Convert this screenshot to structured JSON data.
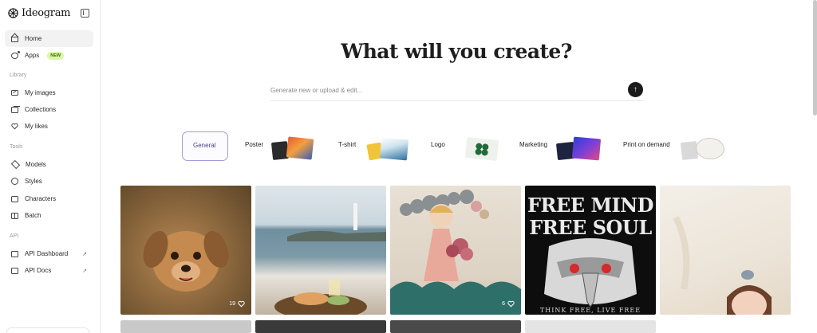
{
  "brand": {
    "name": "Ideogram"
  },
  "sidebar": {
    "sections": {
      "library": "Library",
      "tools": "Tools",
      "api": "API"
    },
    "items": [
      {
        "id": "home",
        "label": "Home",
        "icon": "home-icon"
      },
      {
        "id": "apps",
        "label": "Apps",
        "icon": "apps-icon",
        "badge": "NEW"
      },
      {
        "id": "my-images",
        "label": "My images",
        "icon": "images-icon"
      },
      {
        "id": "collections",
        "label": "Collections",
        "icon": "collections-icon"
      },
      {
        "id": "my-likes",
        "label": "My likes",
        "icon": "heart-icon"
      },
      {
        "id": "models",
        "label": "Models",
        "icon": "models-icon"
      },
      {
        "id": "styles",
        "label": "Styles",
        "icon": "styles-icon"
      },
      {
        "id": "characters",
        "label": "Characters",
        "icon": "characters-icon"
      },
      {
        "id": "batch",
        "label": "Batch",
        "icon": "batch-icon"
      },
      {
        "id": "api-dashboard",
        "label": "API Dashboard",
        "icon": "api-icon",
        "external": "↗"
      },
      {
        "id": "api-docs",
        "label": "API Docs",
        "icon": "docs-icon",
        "external": "↗"
      }
    ]
  },
  "main": {
    "headline": "What will you create?",
    "search": {
      "placeholder": "Generate new or upload & edit...",
      "submit_icon": "↑"
    },
    "categories": [
      {
        "label": "General",
        "selected": true
      },
      {
        "label": "Poster"
      },
      {
        "label": "T-shirt"
      },
      {
        "label": "Logo"
      },
      {
        "label": "Marketing"
      },
      {
        "label": "Print on demand"
      }
    ],
    "gallery": [
      {
        "subject": "puppy",
        "likes": "19"
      },
      {
        "subject": "coast-lighthouse"
      },
      {
        "subject": "doll-with-bouquet",
        "likes": "6"
      },
      {
        "subject": "eagle-tshirt",
        "text_line1": "FREE MIND",
        "text_line2": "FREE SOUL",
        "text_line3": "THINK FREE, LIVE FREE"
      },
      {
        "subject": "watercolor-girl"
      }
    ]
  },
  "colors": {
    "accent_selected": "#a99bd9",
    "badge_bg": "#daf5a8",
    "badge_text": "#3a6b12",
    "submit_bg": "#1a1a1a"
  }
}
